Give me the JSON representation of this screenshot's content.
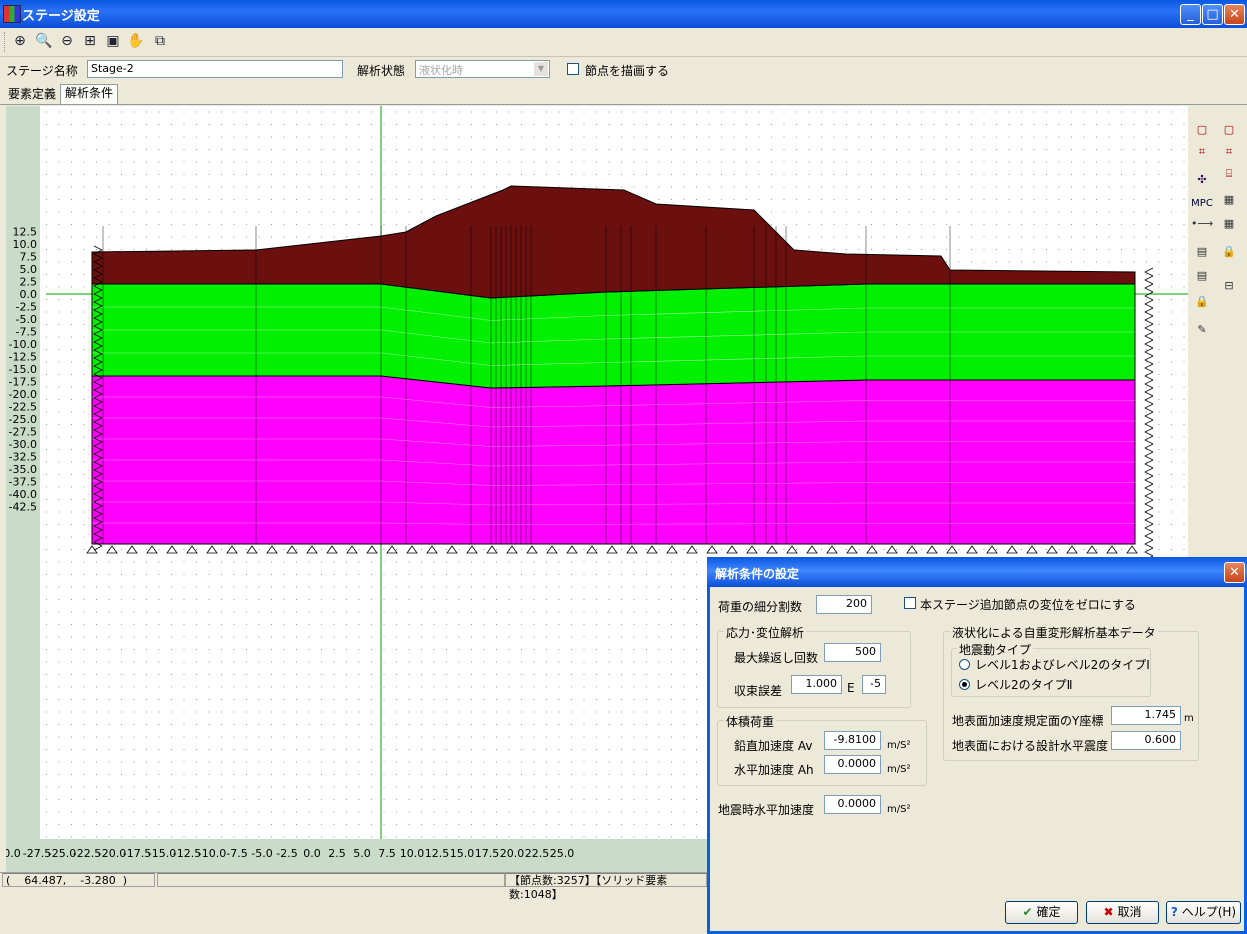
{
  "window": {
    "title": "ステージ設定",
    "minimize": "_",
    "maximize": "□",
    "close": "✕"
  },
  "toolbar": {
    "icons": [
      "zoom-window-icon",
      "zoom-in-icon",
      "zoom-out-icon",
      "fit-all-icon",
      "fit-frame-icon",
      "pan-hand-icon",
      "copy-view-icon"
    ]
  },
  "stage": {
    "name_label": "ステージ名称",
    "name_value": "Stage-2",
    "state_label": "解析状態",
    "state_value": "液状化時",
    "draw_nodes_label": "節点を描画する"
  },
  "tabs": [
    {
      "label": "要素定義"
    },
    {
      "label": "解析条件"
    }
  ],
  "axis": {
    "y_ticks": [
      "12.5",
      "10.0",
      "7.5",
      "5.0",
      "2.5",
      "0.0",
      "-2.5",
      "-5.0",
      "-7.5",
      "-10.0",
      "-12.5",
      "-15.0",
      "-17.5",
      "-20.0",
      "-22.5",
      "-25.0",
      "-27.5",
      "-30.0",
      "-32.5",
      "-35.0",
      "-37.5",
      "-40.0",
      "-42.5"
    ],
    "x_ticks": [
      "0.0",
      "-27.5",
      "-25.0",
      "-22.5",
      "-20.0",
      "-17.5",
      "-15.0",
      "-12.5",
      "-10.0",
      "-7.5",
      "-5.0",
      "-2.5",
      "0.0",
      "2.5",
      "5.0",
      "7.5",
      "10.0",
      "12.5",
      "15.0",
      "17.5",
      "20.0",
      "22.5",
      "25.0"
    ]
  },
  "model": {
    "layer_colors": {
      "embankment": "#6b0f0f",
      "middle": "#00f000",
      "bottom": "#ff00ff",
      "axis": "#00a000"
    }
  },
  "palette": {
    "mpc_label": "MPC"
  },
  "status": {
    "coords": "(    64.487,    -3.280  )",
    "counts": "【節点数:3257】【ソリッド要素数:1048】"
  },
  "dialog": {
    "title": "解析条件の設定",
    "load_div_label": "荷重の細分割数",
    "load_div_value": "200",
    "zero_disp_label": "本ステージ追加節点の変位をゼロにする",
    "stress_group": "応力･変位解析",
    "max_iter_label": "最大繰返し回数",
    "max_iter_value": "500",
    "tol_label": "収束誤差",
    "tol_mantissa": "1.000",
    "tol_e": "E",
    "tol_exp": "-5",
    "body_group": "体積荷重",
    "av_label": "鉛直加速度 Av",
    "av_value": "-9.8100",
    "ah_label": "水平加速度 Ah",
    "ah_value": "0.0000",
    "unit_acc": "m/S²",
    "eq_label": "地震時水平加速度",
    "eq_value": "0.0000",
    "liq_group": "液状化による自重変形解析基本データ",
    "motion_group": "地震動タイプ",
    "radio1": "レベル1およびレベル2のタイプⅠ",
    "radio2": "レベル2のタイプⅡ",
    "ycoord_label": "地表面加速度規定面のY座標",
    "ycoord_value": "1.745",
    "ycoord_unit": "m",
    "kh_label": "地表面における設計水平震度",
    "kh_value": "0.600",
    "ok_label": "確定",
    "cancel_label": "取消",
    "help_label": "ヘルプ(H)"
  }
}
